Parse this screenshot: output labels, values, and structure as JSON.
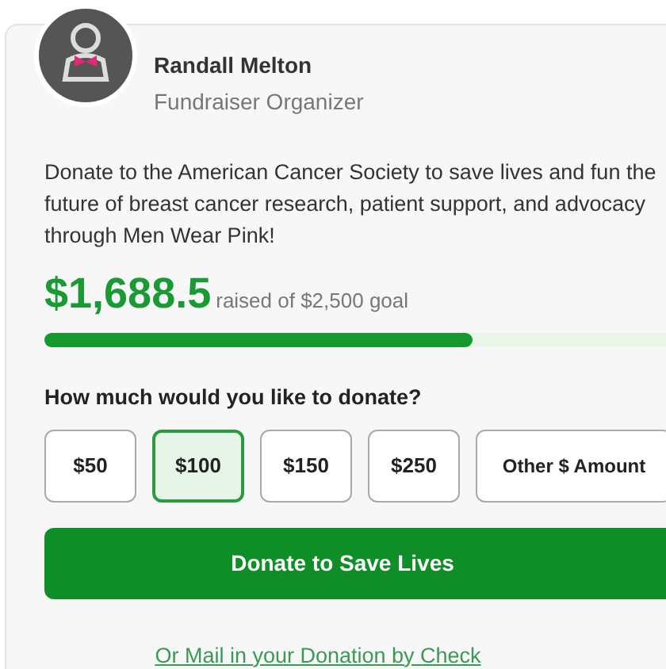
{
  "organizer": {
    "name": "Randall Melton",
    "role": "Fundraiser Organizer"
  },
  "description": "Donate to the American Cancer Society to save lives and fun the future of breast cancer research, patient support, and advocacy through Men Wear Pink!",
  "progress": {
    "raised": "$1,688.5",
    "goal_text": "raised of $2,500 goal",
    "level": 0.675
  },
  "question": "How much would you like to donate?",
  "amounts": [
    {
      "label": "$50",
      "selected": false
    },
    {
      "label": "$100",
      "selected": true
    },
    {
      "label": "$150",
      "selected": false
    },
    {
      "label": "$250",
      "selected": false
    },
    {
      "label": "Other $ Amount",
      "selected": false
    }
  ],
  "donate_button": "Donate to Save Lives",
  "mail_link": "Or Mail in your Donation by Check"
}
